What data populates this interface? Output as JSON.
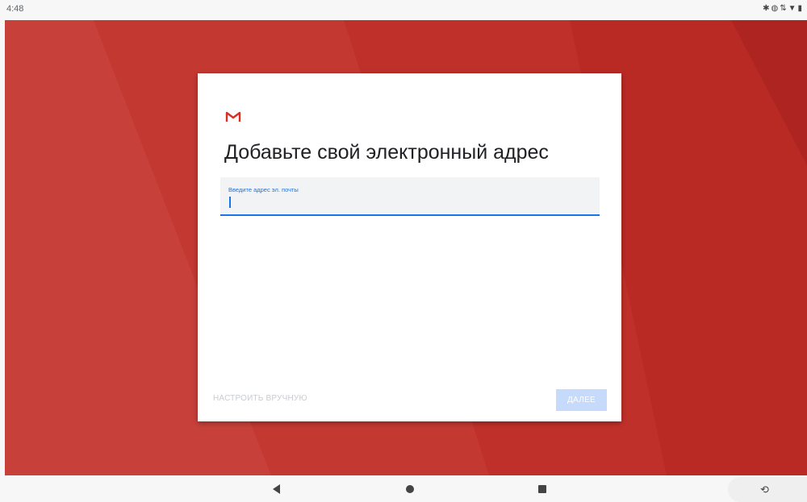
{
  "status_bar": {
    "time": "4:48",
    "icons": [
      "bluetooth-icon",
      "vibrate-icon",
      "data-icon",
      "wifi-icon",
      "battery-icon"
    ]
  },
  "colors": {
    "wallpaper": "#c0302a",
    "accent": "#1a73e8",
    "next_button_bg": "#c6dafc",
    "gmail_red": "#d93025"
  },
  "card": {
    "logo": "gmail-logo-icon",
    "title": "Добавьте свой электронный адрес",
    "email_field": {
      "label": "Введите адрес эл. почты",
      "value": ""
    },
    "manual_setup_label": "НАСТРОИТЬ ВРУЧНУЮ",
    "next_label": "ДАЛЕЕ"
  },
  "nav_bar": {
    "buttons": [
      "back-icon",
      "home-icon",
      "recents-icon",
      "rotate-icon"
    ]
  }
}
